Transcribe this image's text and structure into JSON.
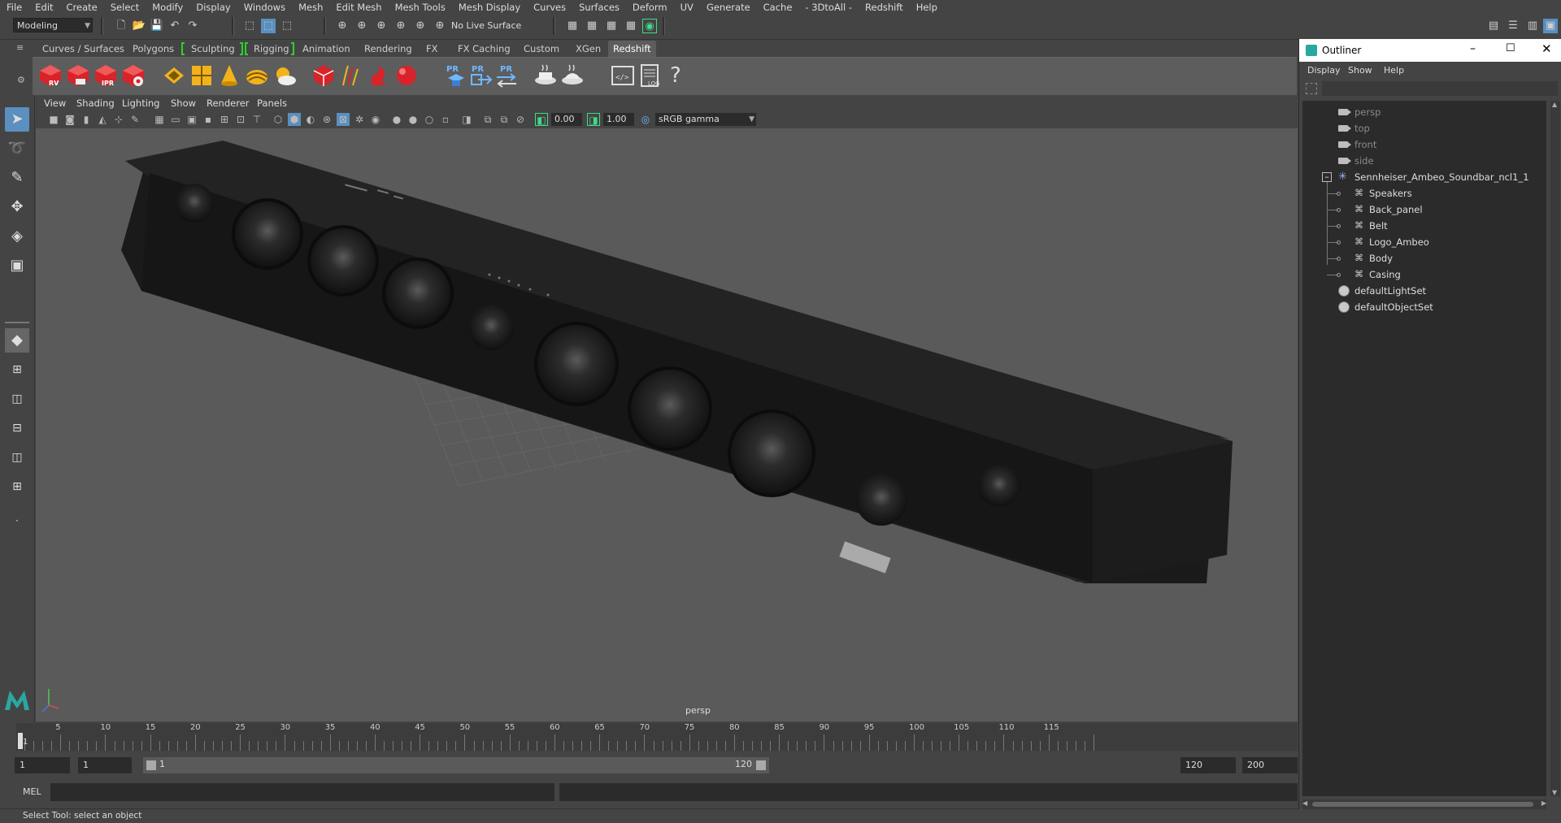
{
  "menubar": {
    "items": [
      "File",
      "Edit",
      "Create",
      "Select",
      "Modify",
      "Display",
      "Windows",
      "Mesh",
      "Edit Mesh",
      "Mesh Tools",
      "Mesh Display",
      "Curves",
      "Surfaces",
      "Deform",
      "UV",
      "Generate",
      "Cache",
      "- 3DtoAll -",
      "Redshift",
      "Help"
    ]
  },
  "statusline": {
    "mode": "Modeling",
    "live_surface": "No Live Surface"
  },
  "shelf": {
    "tabs": [
      "Curves / Surfaces",
      "Polygons",
      "Sculpting",
      "Rigging",
      "Animation",
      "Rendering",
      "FX",
      "FX Caching",
      "Custom",
      "XGen",
      "Redshift"
    ],
    "active_tab": "Redshift",
    "icon_labels": {
      "rv": "RV",
      "ipr": "IPR",
      "pr": "PR",
      "log": "LOG"
    }
  },
  "panel": {
    "menus": [
      "View",
      "Shading",
      "Lighting",
      "Show",
      "Renderer",
      "Panels"
    ],
    "exposure": "0.00",
    "gamma": "1.00",
    "color_space": "sRGB gamma"
  },
  "viewport": {
    "camera_label": "persp"
  },
  "timeline": {
    "ticks": [
      "5",
      "10",
      "15",
      "20",
      "25",
      "30",
      "35",
      "40",
      "45",
      "50",
      "55",
      "60",
      "65",
      "70",
      "75",
      "80",
      "85",
      "90",
      "95",
      "100",
      "105",
      "110",
      "115"
    ],
    "current_frame": "1"
  },
  "range": {
    "start": "1",
    "playback_start": "1",
    "slider_start": "1",
    "slider_end": "120",
    "playback_end": "120",
    "end": "200"
  },
  "cmdline": {
    "label": "MEL"
  },
  "helpline": {
    "text": "Select Tool: select an object"
  },
  "outliner": {
    "title": "Outliner",
    "menus": [
      "Display",
      "Show",
      "Help"
    ],
    "cameras": [
      "persp",
      "top",
      "front",
      "side"
    ],
    "group": "Sennheiser_Ambeo_Soundbar_ncl1_1",
    "children": [
      "Speakers",
      "Back_panel",
      "Belt",
      "Logo_Ambeo",
      "Body",
      "Casing"
    ],
    "sets": [
      "defaultLightSet",
      "defaultObjectSet"
    ]
  },
  "colors": {
    "accent": "#5a8fbf",
    "shelf_bracket": "#2fd02f",
    "redshift_red": "#d8232a"
  }
}
